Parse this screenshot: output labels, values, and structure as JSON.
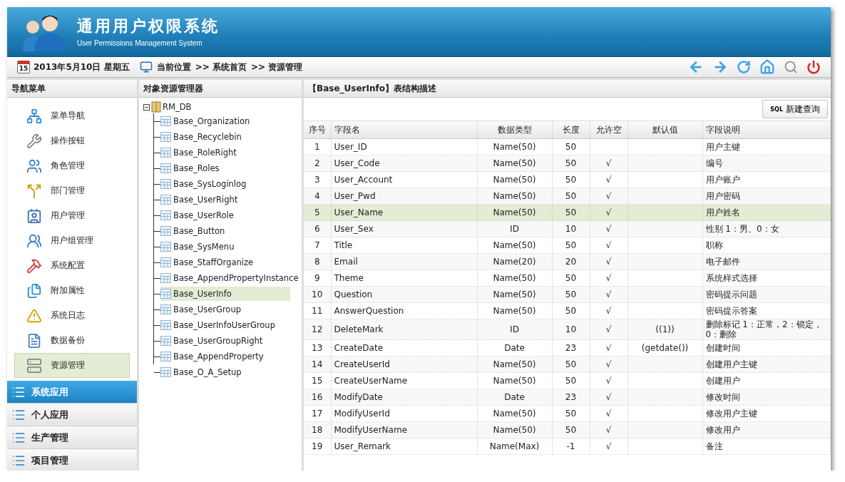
{
  "header": {
    "title": "通用用户权限系统",
    "subtitle": "User Permissions Management System"
  },
  "toolbar": {
    "calendar_day": "15",
    "date": "2013年5月10日 星期五",
    "location_label": "当前位置",
    "breadcrumbs": [
      ">> 系统首页",
      ">> 资源管理"
    ]
  },
  "nav": {
    "title": "导航菜单",
    "items": [
      {
        "label": "菜单导航",
        "selected": false
      },
      {
        "label": "操作按钮",
        "selected": false
      },
      {
        "label": "角色管理",
        "selected": false
      },
      {
        "label": "部门管理",
        "selected": false
      },
      {
        "label": "用户管理",
        "selected": false
      },
      {
        "label": "用户组管理",
        "selected": false
      },
      {
        "label": "系统配置",
        "selected": false
      },
      {
        "label": "附加属性",
        "selected": false
      },
      {
        "label": "系统日志",
        "selected": false
      },
      {
        "label": "数据备份",
        "selected": false
      },
      {
        "label": "资源管理",
        "selected": true
      }
    ],
    "sections": [
      {
        "label": "系统应用",
        "selected": true
      },
      {
        "label": "个人应用",
        "selected": false
      },
      {
        "label": "生产管理",
        "selected": false
      },
      {
        "label": "项目管理",
        "selected": false
      }
    ]
  },
  "tree": {
    "title": "对象资源管理器",
    "root": {
      "label": "RM_DB",
      "expanded": true,
      "selected": false,
      "children": [
        {
          "label": "Base_Organization",
          "selected": false
        },
        {
          "label": "Base_Recyclebin",
          "selected": false
        },
        {
          "label": "Base_RoleRight",
          "selected": false
        },
        {
          "label": "Base_Roles",
          "selected": false
        },
        {
          "label": "Base_SysLoginlog",
          "selected": false
        },
        {
          "label": "Base_UserRight",
          "selected": false
        },
        {
          "label": "Base_UserRole",
          "selected": false
        },
        {
          "label": "Base_Button",
          "selected": false
        },
        {
          "label": "Base_SysMenu",
          "selected": false
        },
        {
          "label": "Base_StaffOrganize",
          "selected": false
        },
        {
          "label": "Base_AppendPropertyInstance",
          "selected": false
        },
        {
          "label": "Base_UserInfo",
          "selected": true
        },
        {
          "label": "Base_UserGroup",
          "selected": false
        },
        {
          "label": "Base_UserInfoUserGroup",
          "selected": false
        },
        {
          "label": "Base_UserGroupRight",
          "selected": false
        },
        {
          "label": "Base_AppendProperty",
          "selected": false
        },
        {
          "label": "Base_O_A_Setup",
          "selected": false
        }
      ]
    }
  },
  "main": {
    "title": "【Base_UserInfo】表结构描述",
    "new_query_button": {
      "icon_text": "SQL",
      "label": "新建查询"
    },
    "table": {
      "columns": [
        "序号",
        "字段名",
        "数据类型",
        "长度",
        "允许空",
        "默认值",
        "字段说明"
      ],
      "rows": [
        {
          "no": "1",
          "name": "User_ID",
          "type": "Name(50)",
          "length": "50",
          "desc": "用户主键",
          "selected": false
        },
        {
          "no": "2",
          "name": "User_Code",
          "type": "Name(50)",
          "length": "50",
          "nullable": "√",
          "desc": "编号",
          "selected": false
        },
        {
          "no": "3",
          "name": "User_Account",
          "type": "Name(50)",
          "length": "50",
          "nullable": "√",
          "desc": "用户账户",
          "selected": false
        },
        {
          "no": "4",
          "name": "User_Pwd",
          "type": "Name(50)",
          "length": "50",
          "nullable": "√",
          "desc": "用户密码",
          "selected": false
        },
        {
          "no": "5",
          "name": "User_Name",
          "type": "Name(50)",
          "length": "50",
          "nullable": "√",
          "desc": "用户姓名",
          "selected": true
        },
        {
          "no": "6",
          "name": "User_Sex",
          "type": "ID",
          "length": "10",
          "nullable": "√",
          "desc": "性别 1：男、0：女",
          "selected": false
        },
        {
          "no": "7",
          "name": "Title",
          "type": "Name(50)",
          "length": "50",
          "nullable": "√",
          "desc": "职称",
          "selected": false
        },
        {
          "no": "8",
          "name": "Email",
          "type": "Name(20)",
          "length": "20",
          "nullable": "√",
          "desc": "电子邮件",
          "selected": false
        },
        {
          "no": "9",
          "name": "Theme",
          "type": "Name(50)",
          "length": "50",
          "nullable": "√",
          "desc": "系统样式选择",
          "selected": false
        },
        {
          "no": "10",
          "name": "Question",
          "type": "Name(50)",
          "length": "50",
          "nullable": "√",
          "desc": "密码提示问题",
          "selected": false
        },
        {
          "no": "11",
          "name": "AnswerQuestion",
          "type": "Name(50)",
          "length": "50",
          "nullable": "√",
          "desc": "密码提示答案",
          "selected": false
        },
        {
          "no": "12",
          "name": "DeleteMark",
          "type": "ID",
          "length": "10",
          "nullable": "√",
          "default": "((1))",
          "desc": "删除标记 1：正常，2：锁定，0：删除",
          "selected": false
        },
        {
          "no": "13",
          "name": "CreateDate",
          "type": "Date",
          "length": "23",
          "nullable": "√",
          "default": "(getdate())",
          "desc": "创建时间",
          "selected": false
        },
        {
          "no": "14",
          "name": "CreateUserId",
          "type": "Name(50)",
          "length": "50",
          "nullable": "√",
          "desc": "创建用户主键",
          "selected": false
        },
        {
          "no": "15",
          "name": "CreateUserName",
          "type": "Name(50)",
          "length": "50",
          "nullable": "√",
          "desc": "创建用户",
          "selected": false
        },
        {
          "no": "16",
          "name": "ModifyDate",
          "type": "Date",
          "length": "23",
          "nullable": "√",
          "desc": "修改时间",
          "selected": false
        },
        {
          "no": "17",
          "name": "ModifyUserId",
          "type": "Name(50)",
          "length": "50",
          "nullable": "√",
          "desc": "修改用户主键",
          "selected": false
        },
        {
          "no": "18",
          "name": "ModifyUserName",
          "type": "Name(50)",
          "length": "50",
          "nullable": "√",
          "desc": "修改用户",
          "selected": false
        },
        {
          "no": "19",
          "name": "User_Remark",
          "type": "Name(Max)",
          "length": "-1",
          "nullable": "√",
          "desc": "备注",
          "selected": false
        }
      ]
    }
  }
}
